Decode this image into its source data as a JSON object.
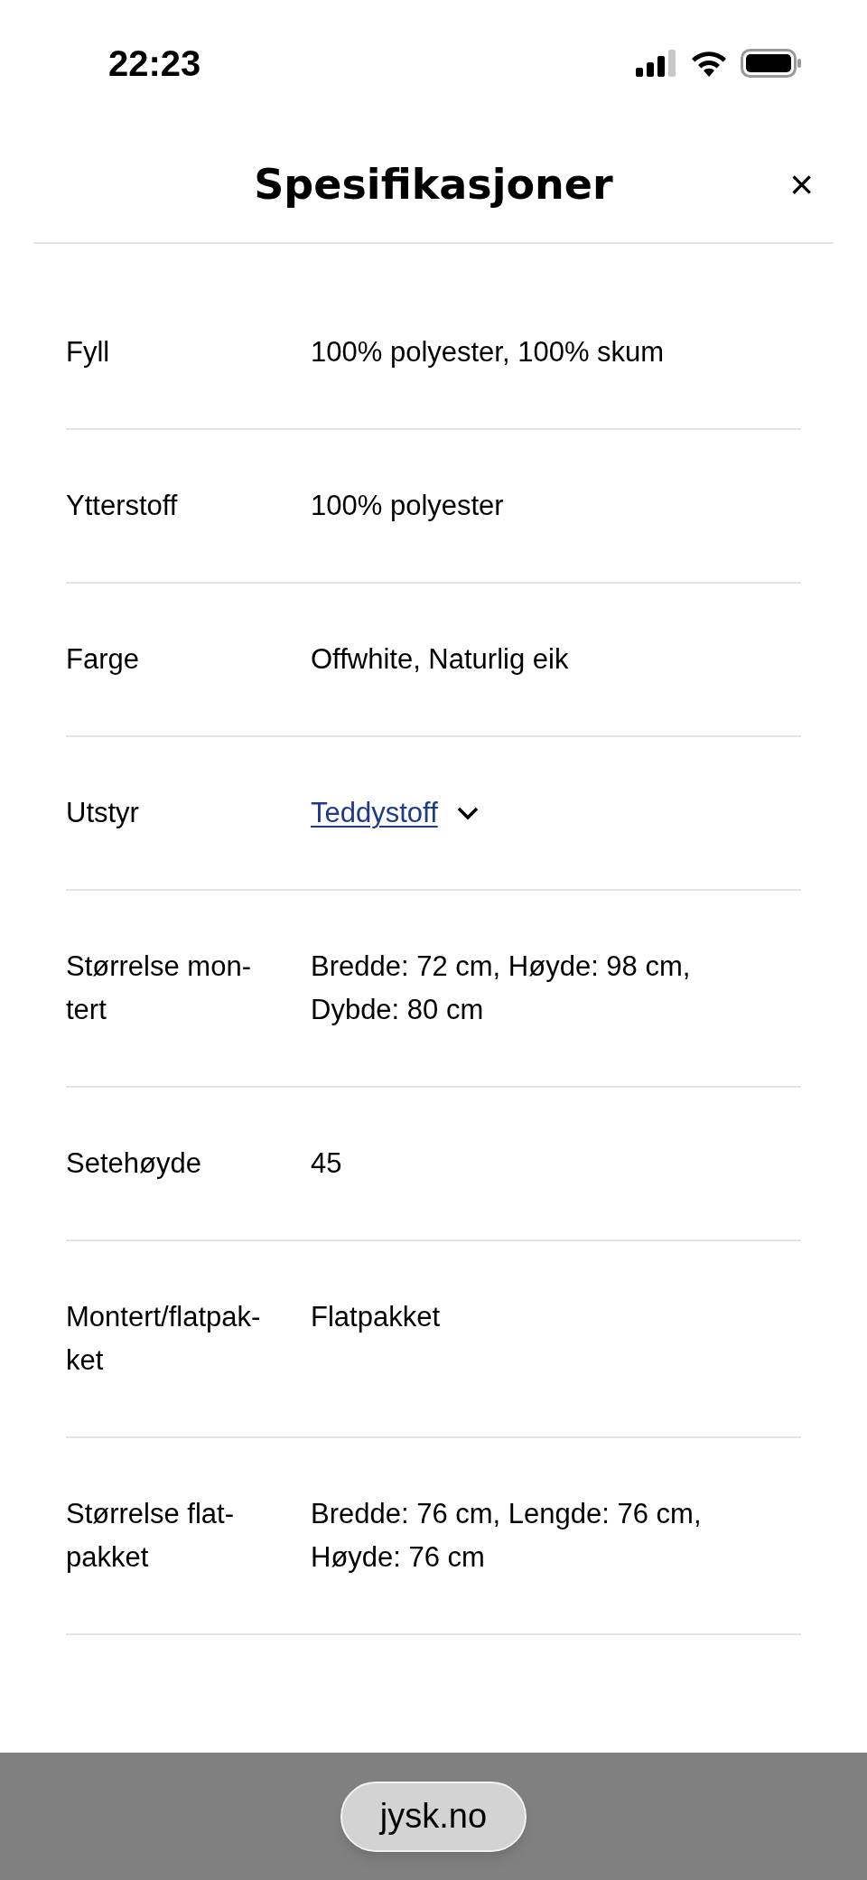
{
  "status_bar": {
    "time": "22:23"
  },
  "sheet": {
    "title": "Spesifikasjoner",
    "close": "×"
  },
  "specs": [
    {
      "label_lines": [
        "Fyll"
      ],
      "value_lines": [
        "100% polyester, 100% skum"
      ],
      "kind": "text"
    },
    {
      "label_lines": [
        "Ytterstoff"
      ],
      "value_lines": [
        "100% polyester"
      ],
      "kind": "text"
    },
    {
      "label_lines": [
        "Farge"
      ],
      "value_lines": [
        "Offwhite, Naturlig eik"
      ],
      "kind": "text"
    },
    {
      "label_lines": [
        "Utstyr"
      ],
      "value_lines": [
        "Teddystoff"
      ],
      "kind": "link",
      "expanded": false
    },
    {
      "label_lines": [
        "Størrelse mon-",
        "tert"
      ],
      "value_lines": [
        "Bredde: 72 cm, Høyde: 98 cm,",
        "Dybde: 80 cm"
      ],
      "kind": "text"
    },
    {
      "label_lines": [
        "Setehøyde"
      ],
      "value_lines": [
        "45"
      ],
      "kind": "text"
    },
    {
      "label_lines": [
        "Montert/flatpak-",
        "ket"
      ],
      "value_lines": [
        "Flatpakket"
      ],
      "kind": "text"
    },
    {
      "label_lines": [
        "Størrelse flat-",
        "pakket"
      ],
      "value_lines": [
        "Bredde: 76 cm, Lengde: 76 cm,",
        "Høyde: 76 cm"
      ],
      "kind": "text"
    }
  ],
  "browser_bar": {
    "address": "jysk.no"
  }
}
